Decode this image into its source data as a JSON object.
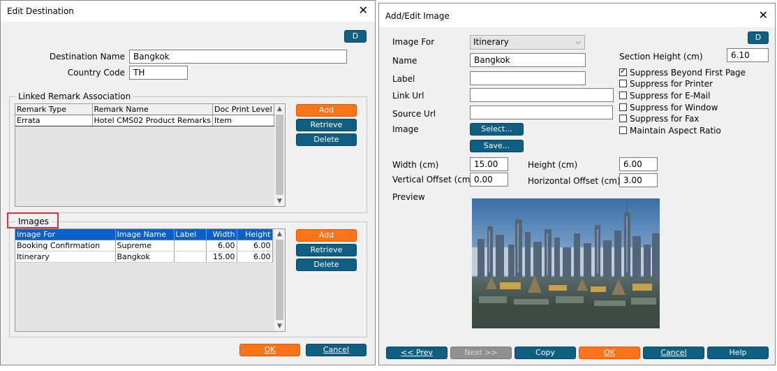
{
  "edit_destination": {
    "title": "Edit Destination",
    "d_button": "D",
    "destination_name_label": "Destination Name",
    "destination_name_value": "Bangkok",
    "country_code_label": "Country Code",
    "country_code_value": "TH",
    "linked_remark": {
      "title": "Linked Remark Association",
      "columns": [
        "Remark Type",
        "Remark Name",
        "Doc Print Level"
      ],
      "rows": [
        [
          "Errata",
          "Hotel CMS02 Product Remarks",
          "Item"
        ]
      ],
      "add": "Add",
      "retrieve": "Retrieve",
      "delete": "Delete"
    },
    "images": {
      "title": "Images",
      "columns": [
        "Image For",
        "Image Name",
        "Label",
        "Width",
        "Height"
      ],
      "rows": [
        [
          "Booking Confirmation",
          "Supreme",
          "",
          "6.00",
          "6.00"
        ],
        [
          "Itinerary",
          "Bangkok",
          "",
          "15.00",
          "6.00"
        ]
      ],
      "add": "Add",
      "retrieve": "Retrieve",
      "delete": "Delete"
    },
    "ok": "OK",
    "cancel": "Cancel"
  },
  "add_edit_image": {
    "title": "Add/Edit Image",
    "d_button": "D",
    "image_for_label": "Image For",
    "image_for_value": "Itinerary",
    "name_label": "Name",
    "name_value": "Bangkok",
    "label_label": "Label",
    "label_value": "",
    "link_url_label": "Link Url",
    "link_url_value": "",
    "source_url_label": "Source Url",
    "source_url_value": "",
    "image_label": "Image",
    "select_button": "Select...",
    "save_button": "Save...",
    "section_height_label": "Section Height (cm)",
    "section_height_value": "6.10",
    "checkboxes": [
      {
        "label": "Suppress Beyond First Page",
        "checked": true
      },
      {
        "label": "Suppress for Printer",
        "checked": false
      },
      {
        "label": "Suppress for E-Mail",
        "checked": false
      },
      {
        "label": "Suppress for Window",
        "checked": false
      },
      {
        "label": "Suppress for Fax",
        "checked": false
      },
      {
        "label": "Maintain Aspect Ratio",
        "checked": false
      }
    ],
    "width_label": "Width (cm)",
    "width_value": "15.00",
    "height_label": "Height (cm)",
    "height_value": "6.00",
    "vertical_offset_label": "Vertical Offset (cm)",
    "vertical_offset_value": "0.00",
    "horizontal_offset_label": "Horizontal Offset (cm)",
    "horizontal_offset_value": "3.00",
    "preview_label": "Preview",
    "footer": {
      "prev": "<< Prev",
      "next": "Next >>",
      "copy": "Copy",
      "ok": "OK",
      "cancel": "Cancel",
      "help": "Help"
    }
  },
  "colors": {
    "blue_button": "#0e5f82",
    "orange_button": "#fb741a",
    "selection": "#0b5fc8",
    "highlight_box": "#d0343c"
  }
}
